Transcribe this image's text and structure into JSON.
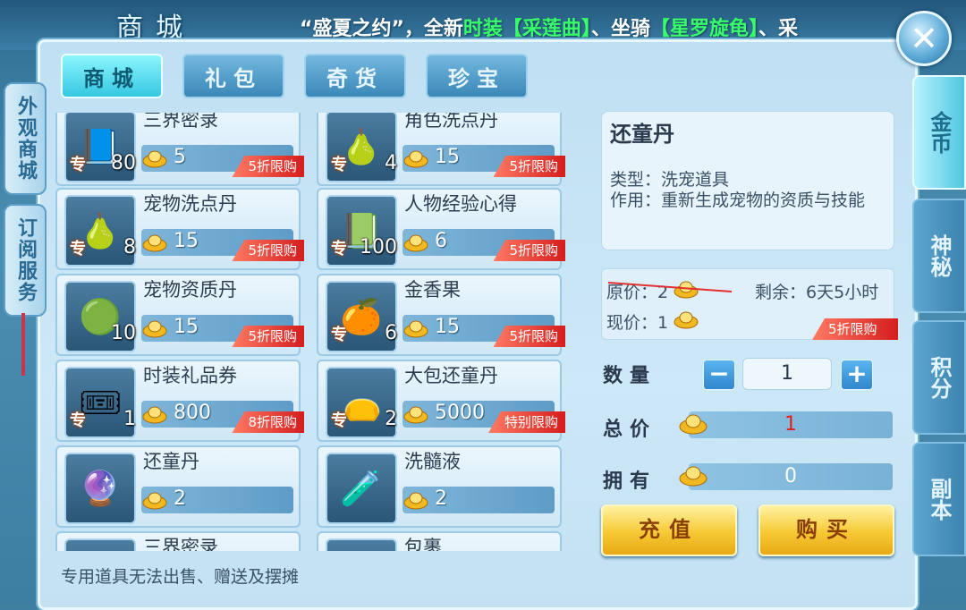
{
  "window": {
    "title": "商城",
    "marquee_prefix": "“盛夏之约”，全新",
    "marquee_green1": "时装【采莲曲】",
    "marquee_mid": "、坐骑",
    "marquee_green2": "【星罗旋龟】",
    "marquee_suffix": "、采"
  },
  "top_tabs": [
    {
      "label": "商城",
      "active": true
    },
    {
      "label": "礼包",
      "active": false
    },
    {
      "label": "奇货",
      "active": false
    },
    {
      "label": "珍宝",
      "active": false
    }
  ],
  "left_tabs": [
    "外观商城",
    "订阅服务"
  ],
  "right_tabs": [
    {
      "label": "金币",
      "active": true
    },
    {
      "label": "神秘",
      "active": false
    },
    {
      "label": "积分",
      "active": false
    },
    {
      "label": "副本",
      "active": false
    }
  ],
  "items": [
    {
      "name": "三界密录",
      "qty": "80",
      "price": "5",
      "badge": "5折限购",
      "icon": "book-icon",
      "glyph": "📘",
      "zhuan": "专"
    },
    {
      "name": "角色洗点丹",
      "qty": "4",
      "price": "15",
      "badge": "5折限购",
      "icon": "gourd-icon",
      "glyph": "🍐",
      "zhuan": "专"
    },
    {
      "name": "宠物洗点丹",
      "qty": "8",
      "price": "15",
      "badge": "5折限购",
      "icon": "gourd-icon",
      "glyph": "🍐",
      "zhuan": "专"
    },
    {
      "name": "人物经验心得",
      "qty": "100",
      "price": "6",
      "badge": "5折限购",
      "icon": "book-icon",
      "glyph": "📗",
      "zhuan": "专"
    },
    {
      "name": "宠物资质丹",
      "qty": "10",
      "price": "15",
      "badge": "5折限购",
      "icon": "orb-icon",
      "glyph": "🟢",
      "zhuan": ""
    },
    {
      "name": "金香果",
      "qty": "6",
      "price": "15",
      "badge": "5折限购",
      "icon": "fruit-icon",
      "glyph": "🍊",
      "zhuan": "专"
    },
    {
      "name": "时装礼品券",
      "qty": "1",
      "price": "800",
      "badge": "8折限购",
      "icon": "ticket-icon",
      "glyph": "🎟",
      "zhuan": "专"
    },
    {
      "name": "大包还童丹",
      "qty": "2",
      "price": "5000",
      "badge": "特别限购",
      "icon": "bag-icon",
      "glyph": "👝",
      "zhuan": "专"
    },
    {
      "name": "还童丹",
      "qty": "",
      "price": "2",
      "badge": "",
      "icon": "pill-icon",
      "glyph": "🔮",
      "zhuan": ""
    },
    {
      "name": "洗髓液",
      "qty": "",
      "price": "2",
      "badge": "",
      "icon": "potion-icon",
      "glyph": "🧪",
      "zhuan": ""
    },
    {
      "name": "三界密录",
      "qty": "",
      "price": "",
      "badge": "",
      "icon": "book-icon",
      "glyph": "",
      "zhuan": ""
    },
    {
      "name": "包裹",
      "qty": "",
      "price": "",
      "badge": "",
      "icon": "bag-icon",
      "glyph": "",
      "zhuan": ""
    }
  ],
  "detail": {
    "name": "还童丹",
    "type_label": "类型：",
    "type_value": "洗宠道具",
    "effect_label": "作用：",
    "effect_value": "重新生成宠物的资质与技能",
    "orig_label": "原价：",
    "orig_value": "2",
    "now_label": "现价：",
    "now_value": "1",
    "remain_label": "剩余：",
    "remain_value": "6天5小时",
    "badge": "5折限购"
  },
  "purchase": {
    "qty_label": "数量",
    "qty_value": "1",
    "total_label": "总价",
    "total_value": "1",
    "own_label": "拥有",
    "own_value": "0",
    "minus": "−",
    "plus": "+",
    "recharge_label": "充值",
    "buy_label": "购买"
  },
  "footer_note": "专用道具无法出售、赠送及摆摊",
  "close_glyph": "✕"
}
